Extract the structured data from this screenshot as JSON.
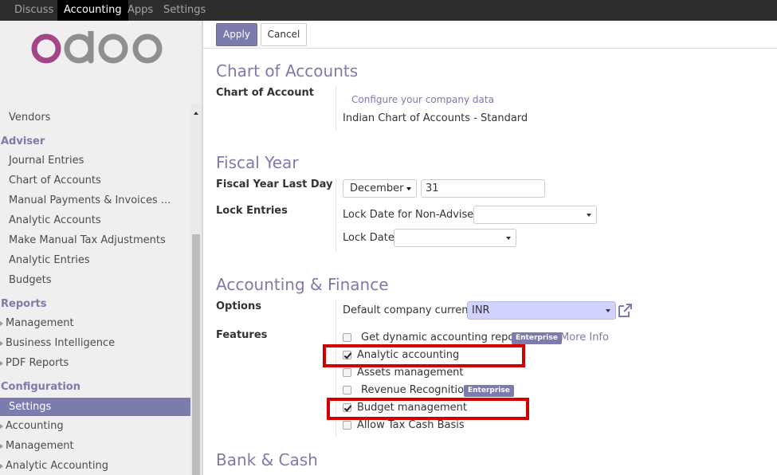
{
  "topnav": {
    "items": [
      "Discuss",
      "Accounting",
      "Apps",
      "Settings"
    ],
    "active": "Accounting"
  },
  "sidebar": {
    "logo_text": "odoo",
    "items": [
      {
        "label": "Vendors"
      },
      {
        "label": "Adviser"
      },
      {
        "label": "Journal Entries"
      },
      {
        "label": "Chart of Accounts"
      },
      {
        "label": "Manual Payments & Invoices ..."
      },
      {
        "label": "Analytic Accounts"
      },
      {
        "label": "Make Manual Tax Adjustments"
      },
      {
        "label": "Analytic Entries"
      },
      {
        "label": "Budgets"
      },
      {
        "label": "Reports"
      },
      {
        "label": "Management"
      },
      {
        "label": "Business Intelligence"
      },
      {
        "label": "PDF Reports"
      },
      {
        "label": "Configuration"
      },
      {
        "label": "Settings"
      },
      {
        "label": "Accounting"
      },
      {
        "label": "Management"
      },
      {
        "label": "Analytic Accounting"
      }
    ]
  },
  "toolbar": {
    "apply_label": "Apply",
    "cancel_label": "Cancel"
  },
  "chart_of_accounts": {
    "title": "Chart of Accounts",
    "field_label": "Chart of Account",
    "configure_link": "Configure your company data",
    "value": "Indian Chart of Accounts - Standard"
  },
  "fiscal_year": {
    "title": "Fiscal Year",
    "last_day_label": "Fiscal Year Last Day",
    "month": "December",
    "day": "31",
    "lock_entries_label": "Lock Entries",
    "lock_non_advisers_label": "Lock Date for Non-Advisers",
    "lock_date_label": "Lock Date"
  },
  "accounting_finance": {
    "title": "Accounting & Finance",
    "options_label": "Options",
    "currency_label": "Default company currency",
    "currency": "INR",
    "features_label": "Features",
    "features": [
      {
        "label": "Get dynamic accounting reports",
        "checked": false,
        "badge": "Enterprise",
        "link": "More Info"
      },
      {
        "label": "Analytic accounting",
        "checked": true
      },
      {
        "label": "Assets management",
        "checked": false
      },
      {
        "label": "Revenue Recognition",
        "checked": false,
        "badge": "Enterprise"
      },
      {
        "label": "Budget management",
        "checked": true
      },
      {
        "label": "Allow Tax Cash Basis",
        "checked": false
      }
    ]
  },
  "bank_cash": {
    "title": "Bank & Cash"
  },
  "colors": {
    "brand": "#7c7bad",
    "highlight": "#d10000",
    "topbar": "#2d2d2d"
  }
}
